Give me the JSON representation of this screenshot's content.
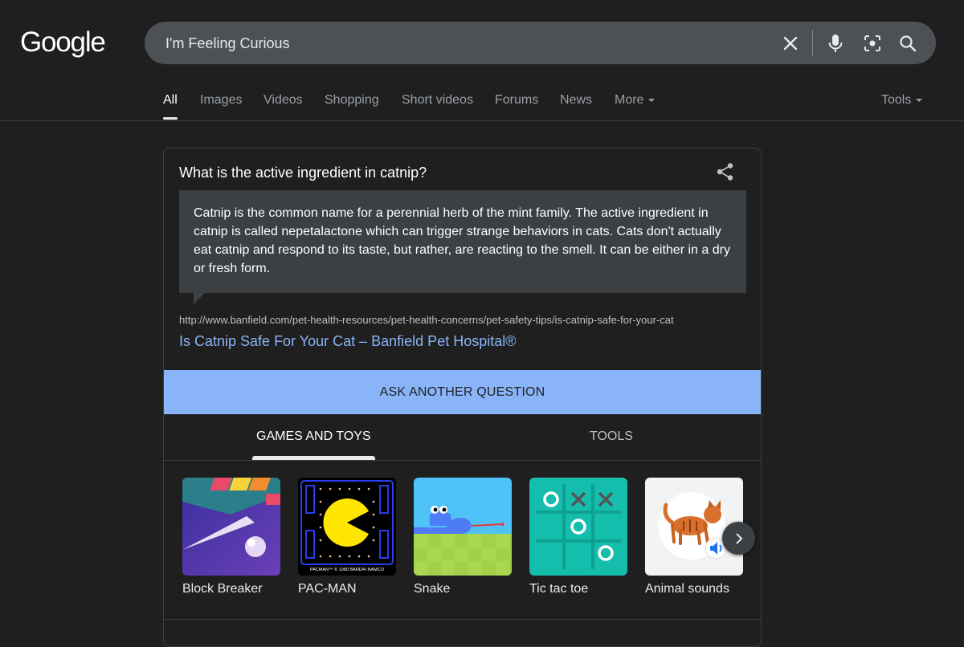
{
  "logo": {
    "text": "Google"
  },
  "search": {
    "query": "I'm Feeling Curious",
    "clear_icon": "close-icon",
    "voice_icon": "mic-icon",
    "lens_icon": "camera-lens-icon",
    "search_icon": "search-icon"
  },
  "tabs": [
    {
      "label": "All",
      "active": true
    },
    {
      "label": "Images"
    },
    {
      "label": "Videos"
    },
    {
      "label": "Shopping"
    },
    {
      "label": "Short videos"
    },
    {
      "label": "Forums"
    },
    {
      "label": "News"
    },
    {
      "label": "More"
    }
  ],
  "tools_label": "Tools",
  "card": {
    "question": "What is the active ingredient in catnip?",
    "answer": "Catnip is the common name for a perennial herb of the mint family. The active ingredient in catnip is called nepetalactone which can trigger strange behaviors in cats. Cats don't actually eat catnip and respond to its taste, but rather, are reacting to the smell. It can be either in a dry or fresh form.",
    "source_url": "http://www.banfield.com/pet-health-resources/pet-health-concerns/pet-safety-tips/is-catnip-safe-for-your-cat",
    "source_title": "Is Catnip Safe For Your Cat – Banfield Pet Hospital®",
    "ask_button": "ASK ANOTHER QUESTION",
    "subtabs": [
      {
        "label": "GAMES AND TOYS",
        "active": true
      },
      {
        "label": "TOOLS"
      }
    ],
    "games": [
      {
        "label": "Block Breaker"
      },
      {
        "label": "PAC-MAN",
        "thumb_caption": "PACMAN™ © 1980 BANDAI NAMCO"
      },
      {
        "label": "Snake"
      },
      {
        "label": "Tic tac toe"
      },
      {
        "label": "Animal sounds"
      }
    ]
  },
  "colors": {
    "background": "#1f1f1f",
    "search_bg": "#4d5156",
    "link": "#8ab4f8",
    "button": "#8ab4f8",
    "answer_bg": "#3c4043"
  }
}
